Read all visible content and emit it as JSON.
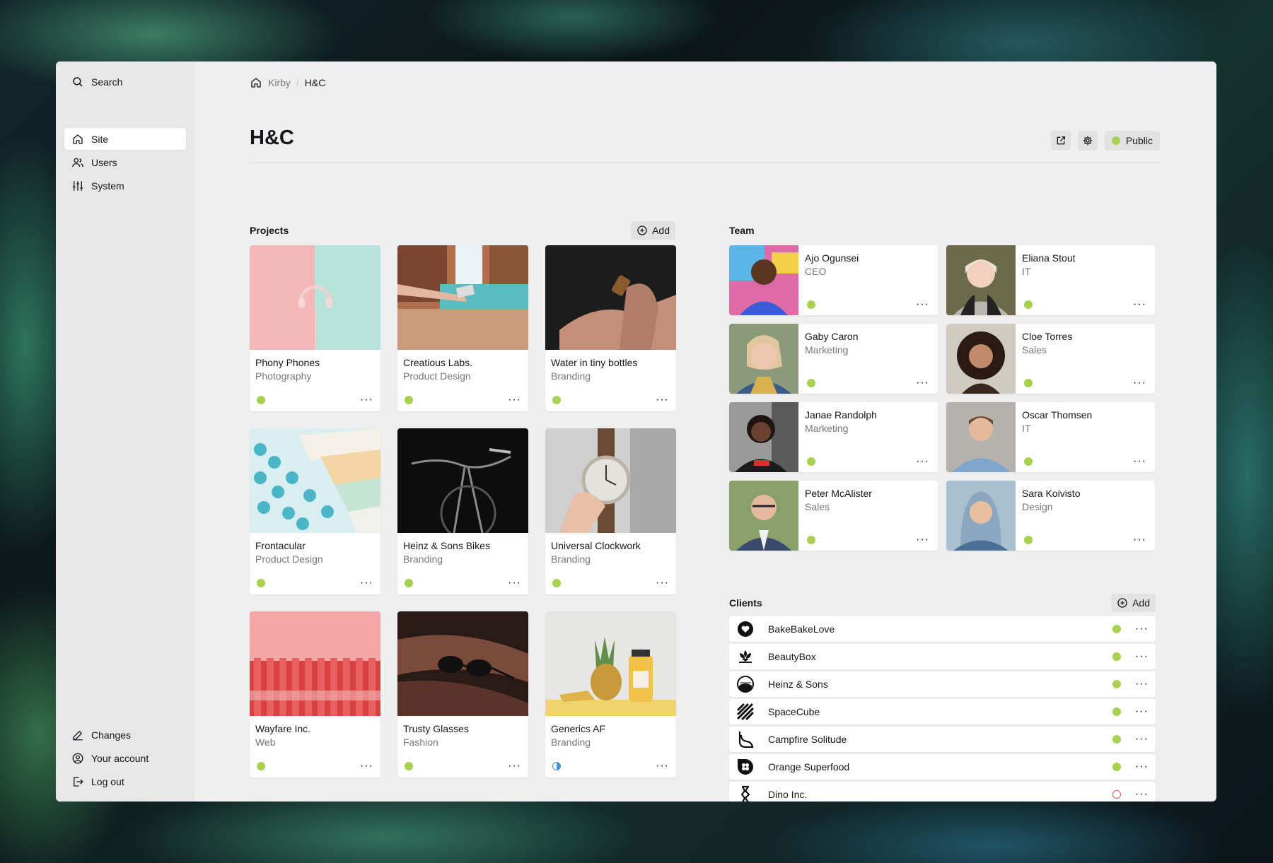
{
  "colors": {
    "status_public": "#a7d14f",
    "status_unlisted": "#4a90e2",
    "status_draft": "#e35a5a",
    "accent": "#16171a"
  },
  "sidebar": {
    "search_label": "Search",
    "nav": [
      {
        "label": "Site",
        "icon": "home-icon",
        "active": true
      },
      {
        "label": "Users",
        "icon": "users-icon"
      },
      {
        "label": "System",
        "icon": "settings-sliders-icon"
      }
    ],
    "bottom": [
      {
        "label": "Changes",
        "icon": "pencil-icon"
      },
      {
        "label": "Your account",
        "icon": "account-icon"
      },
      {
        "label": "Log out",
        "icon": "logout-icon"
      }
    ]
  },
  "breadcrumb": {
    "root": "Kirby",
    "separator": "/",
    "current": "H&C"
  },
  "page": {
    "title": "H&C",
    "status_label": "Public"
  },
  "projects": {
    "heading": "Projects",
    "add_label": "Add",
    "items": [
      {
        "title": "Phony Phones",
        "category": "Photography",
        "status": "public"
      },
      {
        "title": "Creatious Labs.",
        "category": "Product Design",
        "status": "public"
      },
      {
        "title": "Water in tiny bottles",
        "category": "Branding",
        "status": "public"
      },
      {
        "title": "Frontacular",
        "category": "Product Design",
        "status": "public"
      },
      {
        "title": "Heinz & Sons Bikes",
        "category": "Branding",
        "status": "public"
      },
      {
        "title": "Universal Clockwork",
        "category": "Branding",
        "status": "public"
      },
      {
        "title": "Wayfare Inc.",
        "category": "Web",
        "status": "public"
      },
      {
        "title": "Trusty Glasses",
        "category": "Fashion",
        "status": "public"
      },
      {
        "title": "Generics AF",
        "category": "Branding",
        "status": "unlisted"
      }
    ]
  },
  "team": {
    "heading": "Team",
    "members": [
      {
        "name": "Ajo Ogunsei",
        "role": "CEO"
      },
      {
        "name": "Eliana Stout",
        "role": "IT"
      },
      {
        "name": "Gaby Caron",
        "role": "Marketing"
      },
      {
        "name": "Cloe Torres",
        "role": "Sales"
      },
      {
        "name": "Janae Randolph",
        "role": "Marketing"
      },
      {
        "name": "Oscar Thomsen",
        "role": "IT"
      },
      {
        "name": "Peter McAlister",
        "role": "Sales"
      },
      {
        "name": "Sara Koivisto",
        "role": "Design"
      }
    ]
  },
  "clients": {
    "heading": "Clients",
    "add_label": "Add",
    "items": [
      {
        "name": "BakeBakeLove",
        "status": "public",
        "logo": "heart-circle-icon"
      },
      {
        "name": "BeautyBox",
        "status": "public",
        "logo": "lotus-icon"
      },
      {
        "name": "Heinz & Sons",
        "status": "public",
        "logo": "landscape-circle-icon"
      },
      {
        "name": "SpaceCube",
        "status": "public",
        "logo": "stripes-icon"
      },
      {
        "name": "Campfire Solitude",
        "status": "public",
        "logo": "leaf-icon"
      },
      {
        "name": "Orange Superfood",
        "status": "public",
        "logo": "flower-badge-icon"
      },
      {
        "name": "Dino Inc.",
        "status": "draft",
        "logo": "dino-icon"
      }
    ]
  },
  "more_glyph": "···"
}
